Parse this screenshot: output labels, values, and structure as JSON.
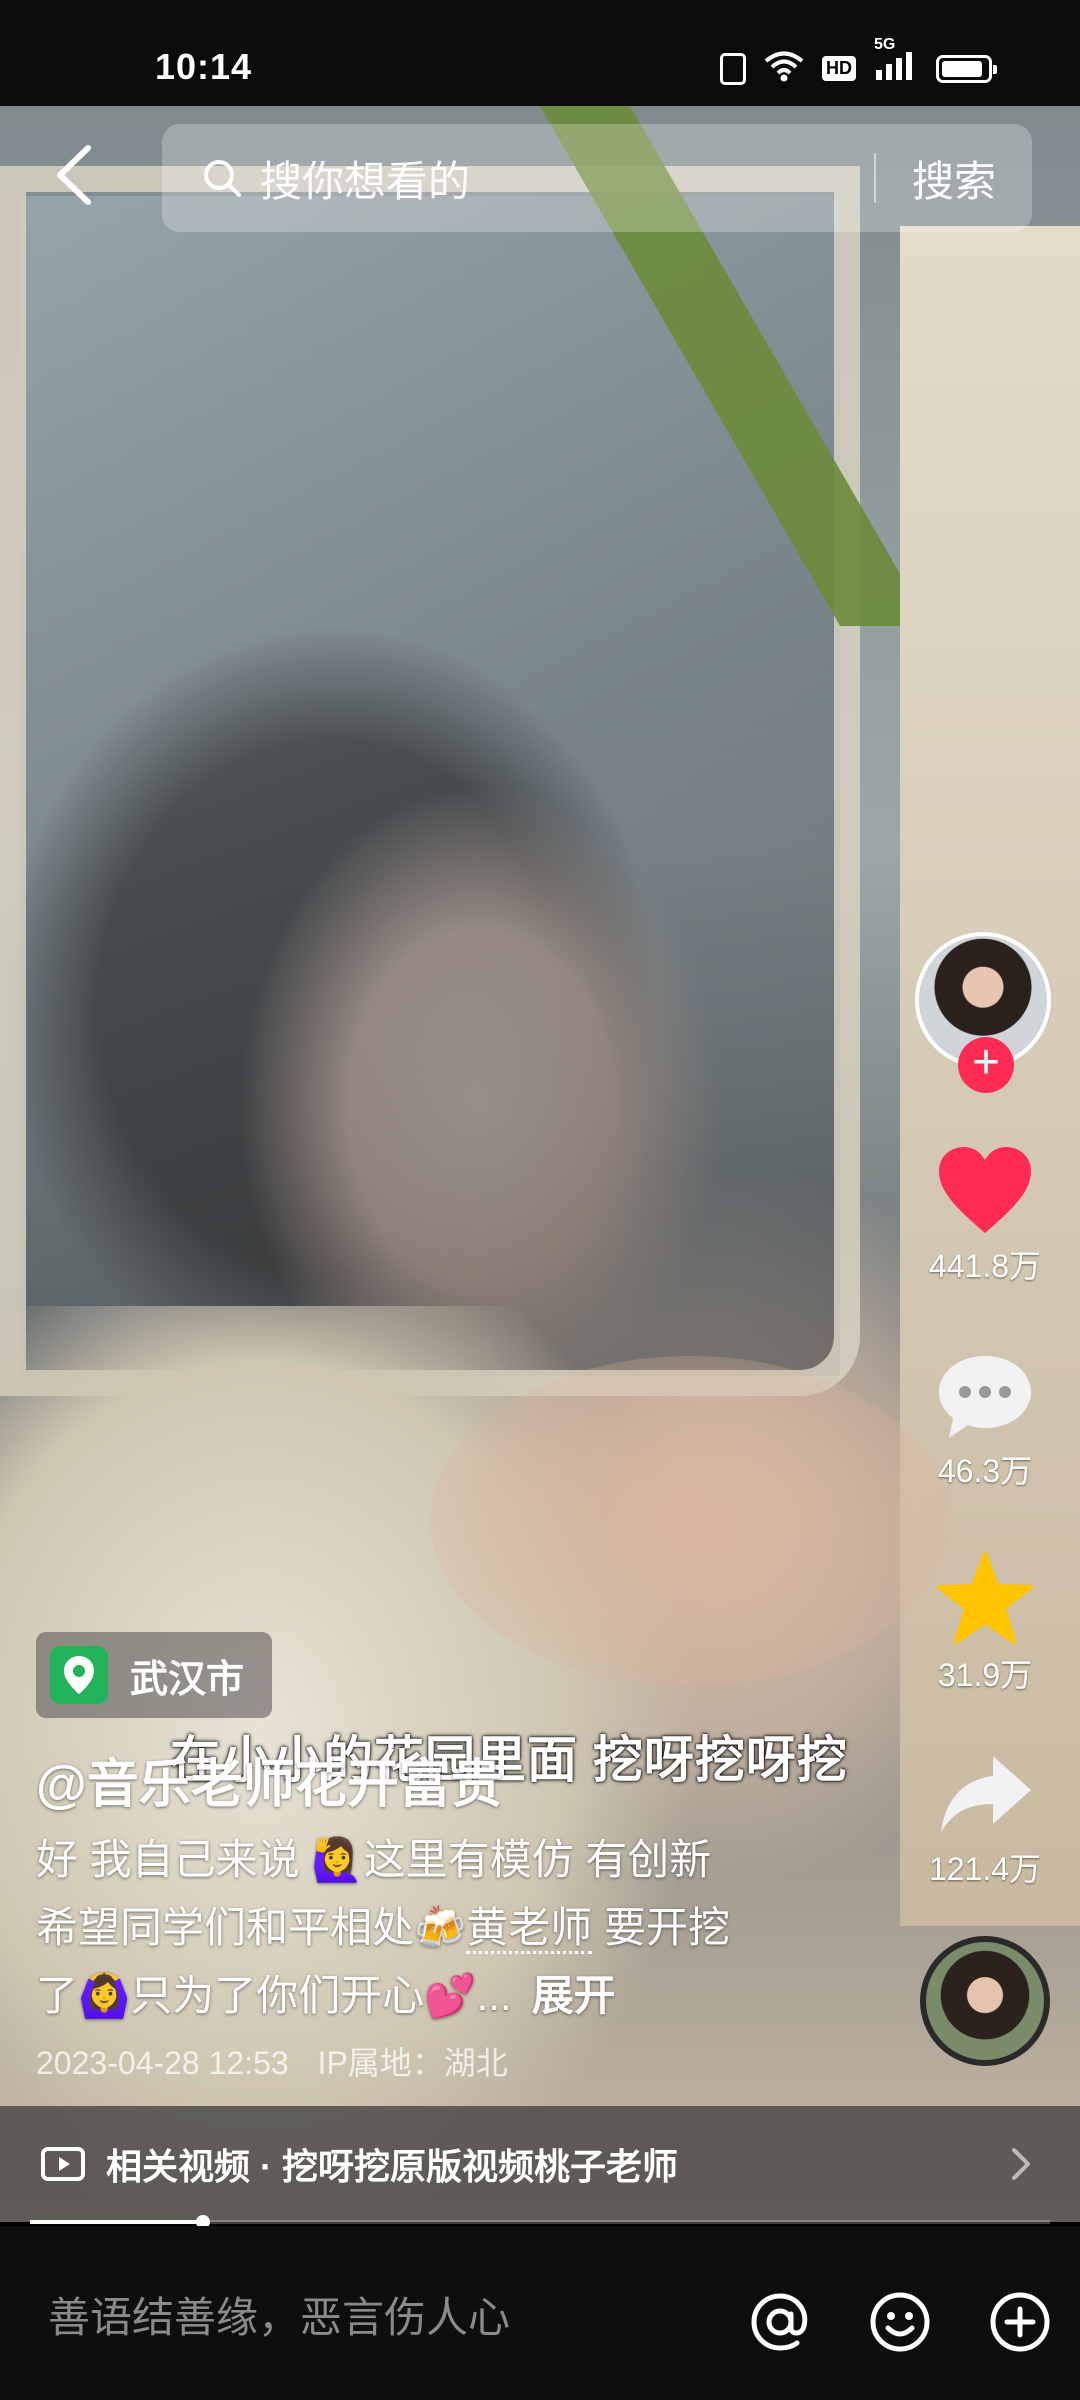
{
  "status_bar": {
    "time": "10:14",
    "hd_label": "HD",
    "network": "5G",
    "battery_level": 0.9
  },
  "search": {
    "placeholder": "搜你想看的",
    "button": "搜索"
  },
  "video": {
    "overlay_caption": "在小小的花园里面 挖呀挖呀挖",
    "progress": 0.17
  },
  "rail": {
    "like_count": "441.8万",
    "comment_count": "46.3万",
    "favorite_count": "31.9万",
    "share_count": "121.4万",
    "follow_symbol": "+"
  },
  "post": {
    "location": "武汉市",
    "author": "@音乐老师花开富贵",
    "desc_line1": "好 我自己来说 🙋‍♀️这里有模仿 有创新",
    "desc_line2a": "希望同学们和平相处🍻",
    "desc_mention": "黄老师",
    "desc_line2b": " 要开挖",
    "desc_line3": "了🙆‍♀️只为了你们开心💕...",
    "expand": "展开",
    "timestamp": "2023-04-28 12:53",
    "ip_location": "IP属地：湖北"
  },
  "related": {
    "text": "相关视频 · 挖呀挖原版视频桃子老师"
  },
  "comment_bar": {
    "placeholder": "善语结善缘，恶言伤人心"
  },
  "colors": {
    "like": "#fe2c55",
    "favorite": "#ffc400",
    "location_pin": "#22b35a"
  }
}
